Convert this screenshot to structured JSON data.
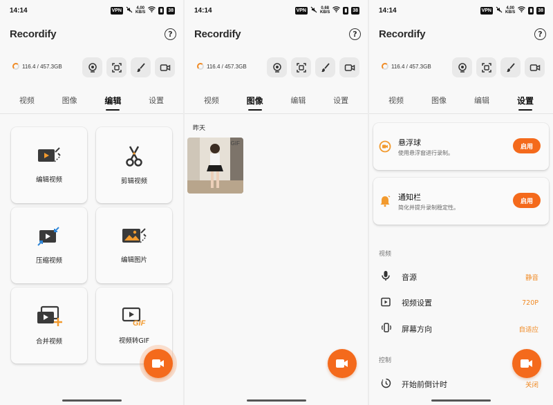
{
  "status": {
    "time": "14:14",
    "vpn": "VPN",
    "speed_value": "4.00",
    "speed_unit": "KB/S",
    "speed_value_2": "0.68",
    "battery": "38"
  },
  "app": {
    "title": "Recordify",
    "help": "?"
  },
  "storage": {
    "text": "116.4 / 457.3GB"
  },
  "tools": [
    {
      "icon": "webcam-icon"
    },
    {
      "icon": "screenshot-icon"
    },
    {
      "icon": "brush-icon"
    },
    {
      "icon": "video-camera-icon"
    }
  ],
  "tabs": [
    "视频",
    "图像",
    "编辑",
    "设置"
  ],
  "edit_cards": [
    {
      "label": "编辑视频",
      "icon": "edit-video-icon"
    },
    {
      "label": "剪辑视频",
      "icon": "scissors-icon"
    },
    {
      "label": "压缩视频",
      "icon": "compress-video-icon"
    },
    {
      "label": "编辑图片",
      "icon": "edit-image-icon"
    },
    {
      "label": "合并视频",
      "icon": "merge-video-icon"
    },
    {
      "label": "视频转GIF",
      "icon": "video-to-gif-icon"
    }
  ],
  "images": {
    "day_label": "昨天",
    "gif_tag": "GIF"
  },
  "settings": {
    "floating": {
      "title": "悬浮球",
      "desc": "使用悬浮窗进行录制。",
      "button": "启用"
    },
    "notify": {
      "title": "通知栏",
      "desc": "简化并提升录制稳定性。",
      "button": "启用"
    },
    "video_section": "视频",
    "rows": [
      {
        "label": "音源",
        "value": "静音",
        "icon": "microphone-icon"
      },
      {
        "label": "视频设置",
        "value": "720P",
        "icon": "play-box-icon"
      },
      {
        "label": "屏幕方向",
        "value": "自适应",
        "icon": "rotate-phone-icon"
      }
    ],
    "control_section": "控制",
    "countdown": {
      "label": "开始前倒计时",
      "value": "关闭",
      "icon": "timer-icon"
    }
  },
  "colors": {
    "accent": "#f46a1c",
    "value_text": "#f08a24"
  }
}
